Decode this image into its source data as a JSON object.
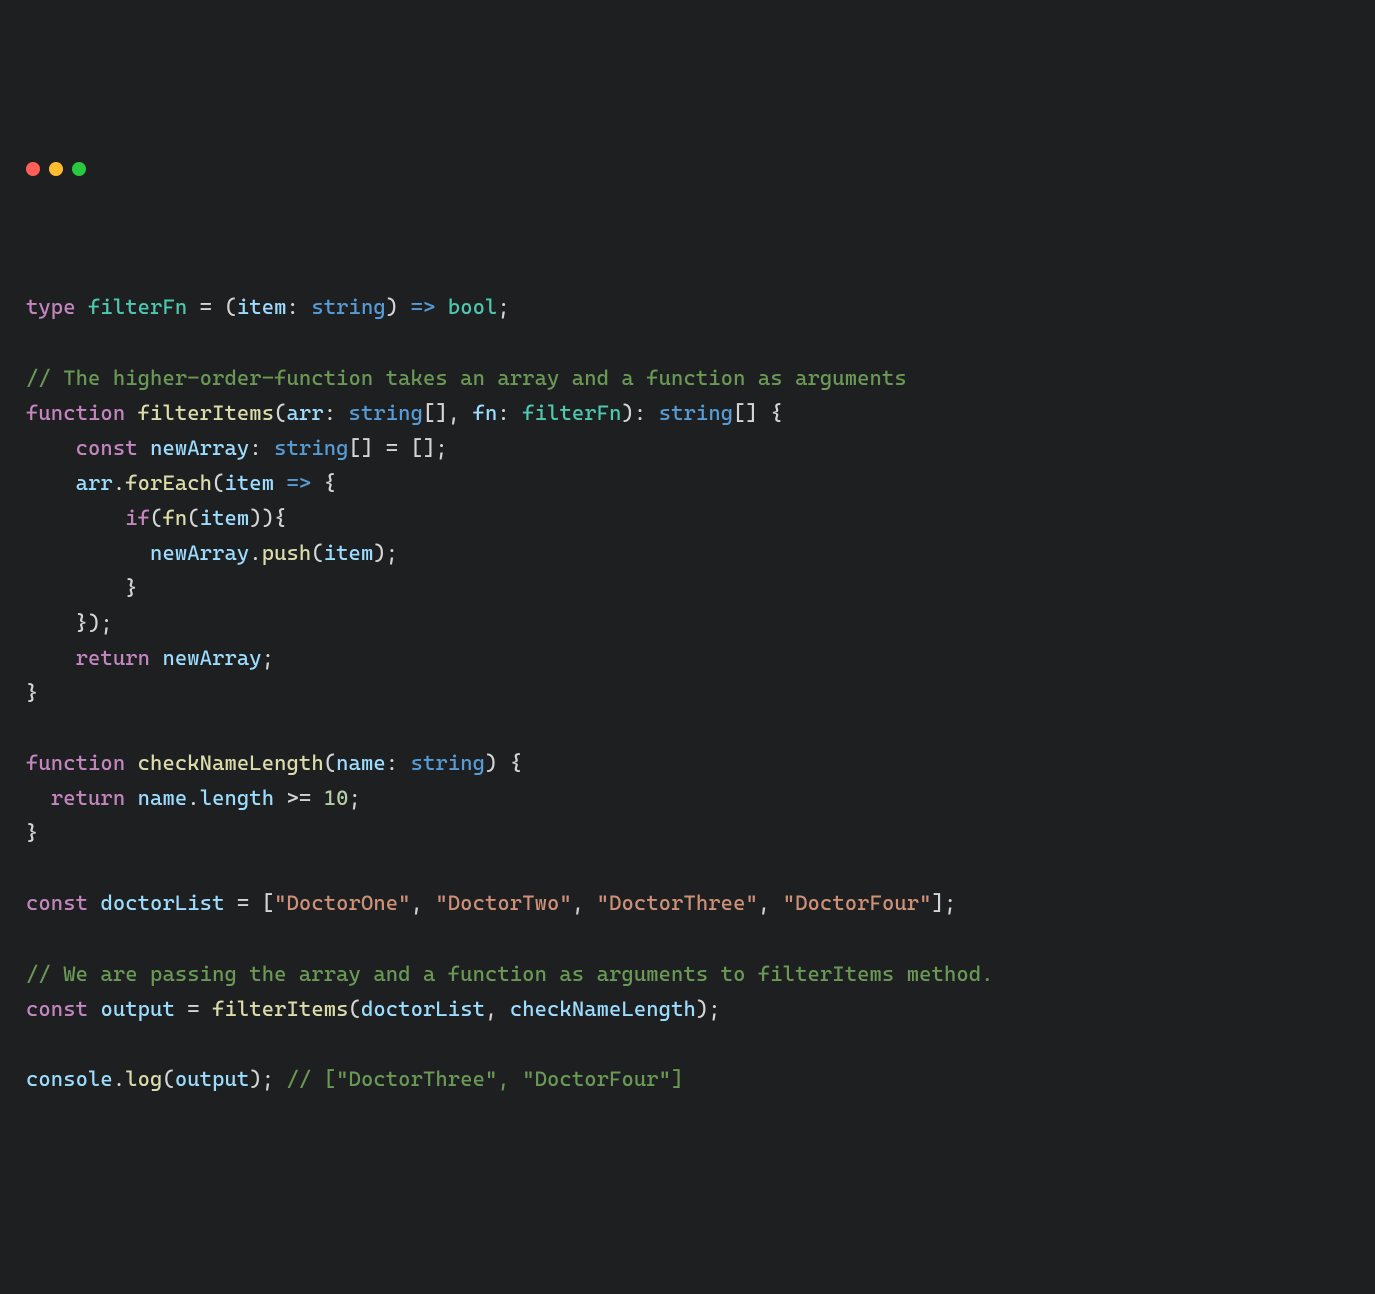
{
  "window": {
    "controls": [
      "close",
      "minimize",
      "zoom"
    ]
  },
  "code": {
    "l1": {
      "kw_type": "type",
      "name": "filterFn",
      "eq": " = ",
      "lp": "(",
      "param": "item",
      "colon": ": ",
      "ptype": "string",
      "rp": ")",
      "arrow": " => ",
      "ret": "bool",
      "semi": ";"
    },
    "l3_comment": "// The higher-order-function takes an array and a function as arguments",
    "l4": {
      "kw_fn": "function",
      "sp": " ",
      "name": "filterItems",
      "lp": "(",
      "p1": "arr",
      "c1": ": ",
      "t1": "string",
      "br1": "[]",
      "comma": ", ",
      "p2": "fn",
      "c2": ": ",
      "t2": "filterFn",
      "rp": ")",
      "c3": ": ",
      "rt": "string",
      "br2": "[]",
      "ob": " {"
    },
    "l5": {
      "indent": "    ",
      "kw": "const",
      "sp": " ",
      "name": "newArray",
      "c": ": ",
      "t": "string",
      "br": "[]",
      "eq": " = []",
      "semi": ";"
    },
    "l6": {
      "indent": "    ",
      "obj": "arr",
      "dot": ".",
      "fn": "forEach",
      "lp": "(",
      "param": "item",
      "arrow": " => ",
      "ob": "{"
    },
    "l7": {
      "indent": "        ",
      "kw": "if",
      "lp": "(",
      "fn": "fn",
      "lp2": "(",
      "arg": "item",
      "rp2": ")",
      "rp": ")",
      "ob": "{"
    },
    "l8": {
      "indent": "          ",
      "obj": "newArray",
      "dot": ".",
      "fn": "push",
      "lp": "(",
      "arg": "item",
      "rp": ")",
      "semi": ";"
    },
    "l9": {
      "indent": "        ",
      "cb": "}"
    },
    "l10": {
      "indent": "    ",
      "cb": "});"
    },
    "l11": {
      "indent": "    ",
      "kw": "return",
      "sp": " ",
      "name": "newArray",
      "semi": ";"
    },
    "l12": {
      "cb": "}"
    },
    "l14": {
      "kw_fn": "function",
      "sp": " ",
      "name": "checkNameLength",
      "lp": "(",
      "p1": "name",
      "c1": ": ",
      "t1": "string",
      "rp": ")",
      "ob": " {"
    },
    "l15": {
      "indent": "  ",
      "kw": "return",
      "sp": " ",
      "obj": "name",
      "dot": ".",
      "prop": "length",
      "op": " >= ",
      "num": "10",
      "semi": ";"
    },
    "l16": {
      "cb": "}"
    },
    "l18": {
      "kw": "const",
      "sp": " ",
      "name": "doctorList",
      "eq": " = ",
      "lb": "[",
      "s1": "\"DoctorOne\"",
      "c1": ", ",
      "s2": "\"DoctorTwo\"",
      "c2": ", ",
      "s3": "\"DoctorThree\"",
      "c3": ", ",
      "s4": "\"DoctorFour\"",
      "rb": "]",
      "semi": ";"
    },
    "l20_comment": "// We are passing the array and a function as arguments to filterItems method.",
    "l21": {
      "kw": "const",
      "sp": " ",
      "name": "output",
      "eq": " = ",
      "fn": "filterItems",
      "lp": "(",
      "a1": "doctorList",
      "comma": ", ",
      "a2": "checkNameLength",
      "rp": ")",
      "semi": ";"
    },
    "l23": {
      "obj": "console",
      "dot": ".",
      "fn": "log",
      "lp": "(",
      "arg": "output",
      "rp": ")",
      "semi": ";",
      "sp": " ",
      "comment": "// [\"DoctorThree\", \"DoctorFour\"]"
    }
  }
}
